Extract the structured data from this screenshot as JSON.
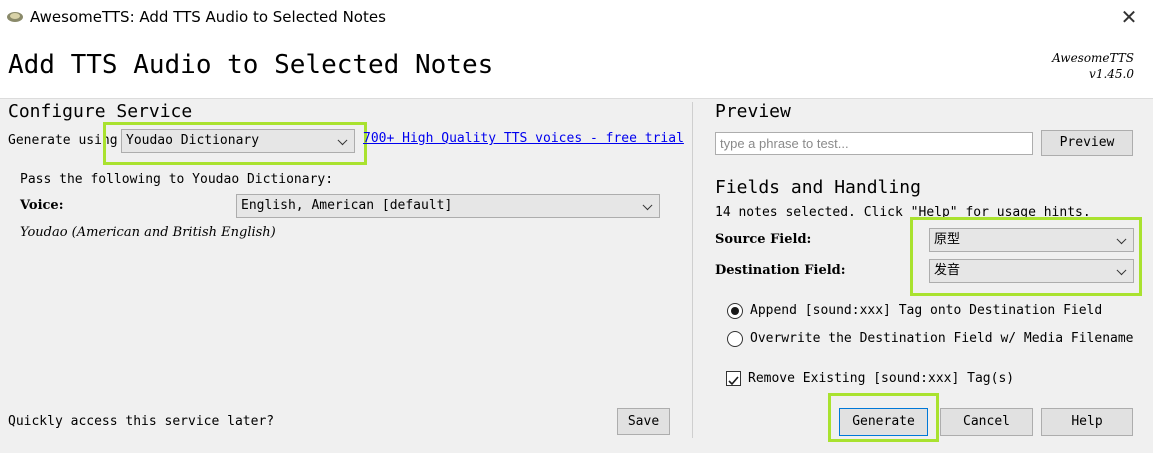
{
  "window": {
    "title": "AwesomeTTS: Add TTS Audio to Selected Notes",
    "icon": "app-icon",
    "close_icon": "close-icon"
  },
  "header": {
    "heading": "Add TTS Audio to Selected Notes",
    "brand_name": "AwesomeTTS",
    "brand_version": "v1.45.0"
  },
  "configure": {
    "section_title": "Configure Service",
    "generate_using_label": "Generate using",
    "service_selected": "Youdao Dictionary",
    "trial_link": "700+ High Quality TTS voices - free trial",
    "pass_following": "Pass the following to Youdao Dictionary:",
    "voice_label": "Voice:",
    "voice_selected": "English, American [default]",
    "service_description": "Youdao (American and British English)",
    "quick_access_label": "Quickly access this service later?",
    "save_button": "Save"
  },
  "preview": {
    "section_title": "Preview",
    "placeholder": "type a phrase to test...",
    "preview_button": "Preview"
  },
  "fields": {
    "section_title": "Fields and Handling",
    "notes_selected": "14 notes selected. Click \"Help\" for usage hints.",
    "source_label": "Source Field:",
    "source_value": "原型",
    "destination_label": "Destination Field:",
    "destination_value": "发音",
    "append_option": "Append [sound:xxx] Tag onto Destination Field",
    "overwrite_option": "Overwrite the Destination Field w/ Media Filename",
    "append_selected": true,
    "remove_existing": "Remove Existing [sound:xxx] Tag(s)",
    "remove_existing_checked": true
  },
  "footer": {
    "generate_button": "Generate",
    "cancel_button": "Cancel",
    "help_button": "Help"
  },
  "colors": {
    "highlight": "#a9e22f",
    "link": "#0000ee",
    "panel_bg": "#f0f0f0"
  }
}
